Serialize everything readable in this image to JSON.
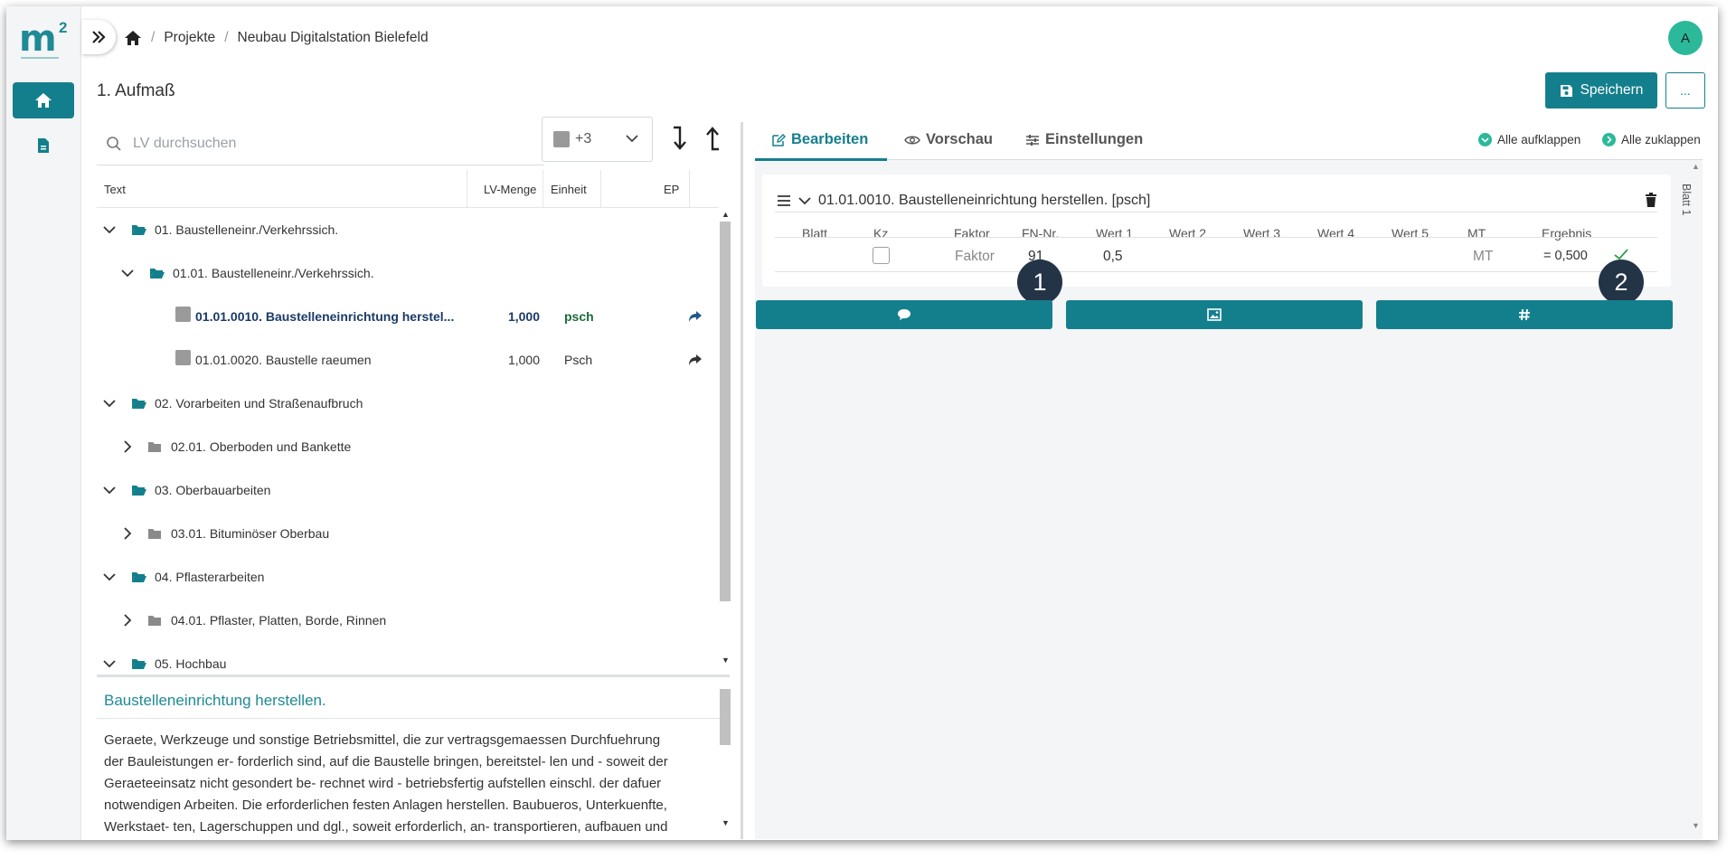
{
  "logo": {
    "text": "m",
    "superscript": "2"
  },
  "rail": {
    "home_icon": "home-icon",
    "doc_icon": "document-icon"
  },
  "breadcrumb": {
    "projects": "Projekte",
    "project": "Neubau Digitalstation Bielefeld"
  },
  "user": {
    "initial": "A"
  },
  "page": {
    "title": "1. Aufmaß"
  },
  "toolbar": {
    "save_label": "Speichern",
    "more_label": "..."
  },
  "search": {
    "placeholder": "LV durchsuchen"
  },
  "filter": {
    "label": "+3"
  },
  "tree": {
    "headers": {
      "text": "Text",
      "qty": "LV-Menge",
      "unit": "Einheit",
      "ep": "EP"
    },
    "rows": [
      {
        "label": "01. Baustelleneinr./Verkehrssich."
      },
      {
        "label": "01.01. Baustelleneinr./Verkehrssich."
      },
      {
        "label": "01.01.0010. Baustelleneinrichtung herstel...",
        "qty": "1,000",
        "unit": "psch"
      },
      {
        "label": "01.01.0020. Baustelle raeumen",
        "qty": "1,000",
        "unit": "Psch"
      },
      {
        "label": "02. Vorarbeiten und Straßenaufbruch"
      },
      {
        "label": "02.01. Oberboden und Bankette"
      },
      {
        "label": "03. Oberbauarbeiten"
      },
      {
        "label": "03.01. Bituminöser Oberbau"
      },
      {
        "label": "04. Pflasterarbeiten"
      },
      {
        "label": "04.01. Pflaster, Platten, Borde, Rinnen"
      },
      {
        "label": "05. Hochbau"
      }
    ]
  },
  "description": {
    "title": "Baustelleneinrichtung herstellen.",
    "lines": [
      "Geraete, Werkzeuge und sonstige Betriebsmittel, die zur vertragsgemaessen Durchfuehrung",
      "der Bauleistungen er- forderlich sind, auf die Baustelle bringen, bereitstel- len und - soweit der",
      "Geraeteeinsatz nicht gesondert be- rechnet wird - betriebsfertig aufstellen einschl. der dafuer",
      "notwendigen Arbeiten. Die erforderlichen festen Anlagen herstellen. Baubueros, Unterkuenfte,",
      "Werkstaet- ten, Lagerschuppen und dgl., soweit erforderlich, an- transportieren, aufbauen und"
    ]
  },
  "tabs": {
    "edit": "Bearbeiten",
    "preview": "Vorschau",
    "settings": "Einstellungen"
  },
  "expand": {
    "expand_all": "Alle aufklappen",
    "collapse_all": "Alle zuklappen"
  },
  "sheet": {
    "label": "Blatt 1"
  },
  "position": {
    "title": "01.01.0010. Baustelleneinrichtung herstellen. [psch]",
    "columns": [
      "Blatt",
      "Kz",
      "Faktor",
      "FN-Nr.",
      "Wert 1",
      "Wert 2",
      "Wert 3",
      "Wert 4",
      "Wert 5",
      "MT",
      "Ergebnis"
    ],
    "row": {
      "faktor": "Faktor",
      "fn_nr": "91",
      "wert1": "0,5",
      "mt": "MT",
      "ergebnis": "= 0,500"
    }
  },
  "badges": {
    "one": "1",
    "two": "2"
  },
  "colors": {
    "accent": "#147f8c",
    "badge": "#243447",
    "avatar": "#2bb99a",
    "check": "#2e9e45"
  }
}
